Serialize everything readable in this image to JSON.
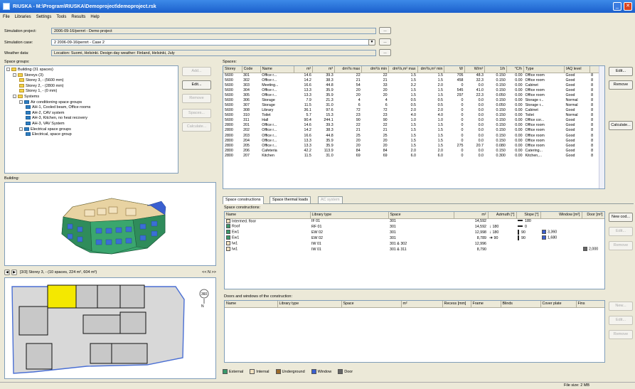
{
  "window": {
    "title": "RIUSKA - M:\\Program\\RIUSKA\\Demoproject\\demoproject.rsk"
  },
  "menu": [
    "File",
    "Libraries",
    "Settings",
    "Tools",
    "Results",
    "Help"
  ],
  "form": {
    "project_label": "Simulation project:",
    "project_value": "2006-09-16/pernrt - Demo project",
    "case_label": "Simulation case:",
    "case_value": "2  2006-09-16/pernrt - Case 2",
    "weather_label": "Weather data:",
    "weather_value": "Location: Suomi, Helsinki. Design day weather: Finland, Helsinki, July"
  },
  "space_groups": {
    "label": "Space groups:",
    "tree": [
      {
        "text": "Building (31 spaces)",
        "indent": 0,
        "icon": "folder",
        "pm": "-"
      },
      {
        "text": "Storeys (3)",
        "indent": 1,
        "icon": "folder",
        "pm": "-"
      },
      {
        "text": "Storey 3, - (5600 mm)",
        "indent": 2,
        "icon": "folder",
        "pm": ""
      },
      {
        "text": "Storey 2, - (2800 mm)",
        "indent": 2,
        "icon": "folder",
        "pm": ""
      },
      {
        "text": "Storey 1, - (0 mm)",
        "indent": 2,
        "icon": "folder",
        "pm": ""
      },
      {
        "text": "Systems",
        "indent": 1,
        "icon": "folder",
        "pm": "-"
      },
      {
        "text": "Air conditioning space groups",
        "indent": 2,
        "icon": "system",
        "pm": "-"
      },
      {
        "text": "AH-1, Cooled beam, Office rooms",
        "indent": 3,
        "icon": "system",
        "pm": ""
      },
      {
        "text": "AH-2, CAV system",
        "indent": 3,
        "icon": "system",
        "pm": ""
      },
      {
        "text": "AH-3, Kitchen, no heat recovery",
        "indent": 3,
        "icon": "system",
        "pm": ""
      },
      {
        "text": "AH-3, VAV System",
        "indent": 3,
        "icon": "system",
        "pm": ""
      },
      {
        "text": "Electrical space groups",
        "indent": 2,
        "icon": "system",
        "pm": "-"
      },
      {
        "text": "Electrical, space group",
        "indent": 3,
        "icon": "system",
        "pm": ""
      }
    ],
    "buttons": {
      "add": "Add...",
      "edit": "Edit...",
      "remove": "Remove",
      "spaces": "Spaces...",
      "calculate": "Calculate..."
    }
  },
  "building_label": "Building:",
  "floor_nav": {
    "text": "[3/3] Storey 3, - (10 spaces, 224 m², 604 m³)",
    "zoom": "<< N >>",
    "compass": "N"
  },
  "spaces": {
    "label": "Spaces:",
    "columns": [
      "Storey",
      "Code",
      "Name",
      "m²",
      "m³",
      "dm³/s max",
      "dm³/s min",
      "dm³/s,m² max",
      "dm³/s,m² min",
      "W",
      "W/m²",
      "1/h",
      "°C/h",
      "Type",
      "IAQ level"
    ],
    "rows": [
      [
        "5600",
        "301",
        "Office r...",
        "14.6",
        "39.3",
        "22",
        "22",
        "1.5",
        "1.5",
        "705",
        "48.3",
        "0.150",
        "0.00",
        "Office room",
        "Good",
        "8"
      ],
      [
        "5600",
        "302",
        "Office r...",
        "14.2",
        "38.3",
        "21",
        "21",
        "1.5",
        "1.5",
        "458",
        "32.3",
        "0.150",
        "0.00",
        "Office room",
        "Good",
        "8"
      ],
      [
        "5600",
        "303",
        "Meeting...",
        "16.6",
        "44.8",
        "54",
        "33",
        "3.2",
        "2.0",
        "0",
        "0.0",
        "0.150",
        "0.00",
        "Cabinet",
        "Good",
        "8"
      ],
      [
        "5600",
        "304",
        "Office r...",
        "13.3",
        "35.9",
        "20",
        "20",
        "1.5",
        "1.5",
        "545",
        "41.0",
        "0.150",
        "0.00",
        "Office room",
        "Good",
        "8"
      ],
      [
        "5600",
        "305",
        "Office r...",
        "13.3",
        "35.9",
        "20",
        "20",
        "1.5",
        "1.5",
        "297",
        "22.3",
        "0.050",
        "0.00",
        "Office room",
        "Good",
        "8"
      ],
      [
        "5600",
        "306",
        "Storage",
        "7.9",
        "21.3",
        "4",
        "4",
        "0.5",
        "0.5",
        "0",
        "0.0",
        "0.150",
        "0.00",
        "Storage r...",
        "Normal",
        "8"
      ],
      [
        "5600",
        "307",
        "Storage",
        "11.5",
        "31.0",
        "6",
        "6",
        "0.5",
        "0.5",
        "0",
        "0.0",
        "0.050",
        "0.00",
        "Storage r...",
        "Normal",
        "8"
      ],
      [
        "5600",
        "308",
        "Library",
        "36.1",
        "97.6",
        "72",
        "72",
        "2.0",
        "2.0",
        "0",
        "0.0",
        "0.150",
        "0.00",
        "Cabinet",
        "Good",
        "8"
      ],
      [
        "5600",
        "310",
        "Toilet",
        "5.7",
        "15.3",
        "23",
        "23",
        "4.0",
        "4.0",
        "0",
        "0.0",
        "0.150",
        "0.00",
        "Toilet",
        "Normal",
        "8"
      ],
      [
        "5600",
        "311",
        "Hall",
        "90.4",
        "244.1",
        "90",
        "90",
        "1.0",
        "1.0",
        "0",
        "0.0",
        "0.150",
        "0.00",
        "Office cor...",
        "Good",
        "8"
      ],
      [
        "2800",
        "201",
        "Office r...",
        "14.6",
        "39.3",
        "22",
        "22",
        "1.5",
        "1.5",
        "0",
        "0.0",
        "0.150",
        "0.00",
        "Office room",
        "Good",
        "8"
      ],
      [
        "2800",
        "202",
        "Office r...",
        "14.2",
        "38.3",
        "21",
        "21",
        "1.5",
        "1.5",
        "0",
        "0.0",
        "0.150",
        "0.00",
        "Office room",
        "Good",
        "8"
      ],
      [
        "2800",
        "203",
        "Office r...",
        "16.6",
        "44.8",
        "25",
        "25",
        "1.5",
        "1.5",
        "0",
        "0.0",
        "0.150",
        "0.00",
        "Office room",
        "Good",
        "8"
      ],
      [
        "2800",
        "204",
        "Office r...",
        "13.3",
        "35.9",
        "20",
        "20",
        "1.5",
        "1.5",
        "0",
        "0.0",
        "0.150",
        "0.00",
        "Office room",
        "Good",
        "8"
      ],
      [
        "2800",
        "205",
        "Office r...",
        "13.3",
        "35.9",
        "20",
        "20",
        "1.5",
        "1.5",
        "275",
        "20.7",
        "0.080",
        "0.00",
        "Office room",
        "Good",
        "8"
      ],
      [
        "2800",
        "206",
        "Cafeteria",
        "42.2",
        "113.9",
        "84",
        "84",
        "2.0",
        "2.0",
        "0",
        "0.0",
        "0.150",
        "0.00",
        "Catering...",
        "Good",
        "8"
      ],
      [
        "2800",
        "207",
        "Kitchen",
        "11.5",
        "31.0",
        "69",
        "69",
        "6.0",
        "6.0",
        "0",
        "0.0",
        "0.300",
        "0.00",
        "Kitchen,...",
        "Good",
        "8"
      ]
    ],
    "buttons": {
      "edit": "Edit...",
      "remove": "Remove",
      "calculate": "Calculate..."
    }
  },
  "tabs": [
    "Space constructions",
    "Space thermal loads",
    "AC system"
  ],
  "constructions": {
    "label": "Space constructions:",
    "columns": [
      "Name",
      "Library type",
      "Space",
      "m²",
      "Azimuth [°]",
      "Slope [°]",
      "Window [m²]",
      "Door [m²]"
    ],
    "rows": [
      {
        "name": "Intermed. floor",
        "type": "IF 01",
        "space": "301",
        "area": "14,592",
        "az": "",
        "slope": "180",
        "win": "",
        "door": "",
        "color": "#f2e2bf"
      },
      {
        "name": "Roof",
        "type": "RF 01",
        "space": "301",
        "area": "14,592",
        "az": "180",
        "slope": "0",
        "win": "",
        "door": "",
        "color": "#3a9a6a"
      },
      {
        "name": "Ew1",
        "type": "EW 02",
        "space": "301",
        "area": "12,998",
        "az": "180",
        "slope": "90",
        "win": "3,360",
        "door": "",
        "color": "#3a9a6a"
      },
      {
        "name": "Ew1",
        "type": "EW 02",
        "space": "301",
        "area": "8,789",
        "az": "90",
        "slope": "90",
        "win": "1,680",
        "door": "",
        "color": "#3a9a6a"
      },
      {
        "name": "Iw1",
        "type": "IW 01",
        "space": "301 & 302",
        "area": "12,996",
        "az": "",
        "slope": "",
        "win": "",
        "door": "",
        "color": "#f2e2bf"
      },
      {
        "name": "Iw1",
        "type": "IW 01",
        "space": "301 & 311",
        "area": "8,790",
        "az": "",
        "slope": "",
        "win": "",
        "door": "2,000",
        "color": "#f2e2bf"
      }
    ],
    "buttons": {
      "new": "New cod...",
      "edit": "Edit...",
      "remove": "Remove"
    }
  },
  "doors_windows": {
    "label": "Doors and windows of the construction:",
    "columns": [
      "Name",
      "Library type",
      "Space",
      "m²",
      "Recess [mm]",
      "Frame",
      "Blinds",
      "Cover plate",
      "Fins"
    ],
    "buttons": {
      "new": "New...",
      "edit": "Edit...",
      "remove": "Remove"
    }
  },
  "legend": [
    {
      "label": "External",
      "color": "#3a9a6a"
    },
    {
      "label": "Internal",
      "color": "#f2e2bf"
    },
    {
      "label": "Underground",
      "color": "#9a6a2a"
    },
    {
      "label": "Window",
      "color": "#3a5fd0"
    },
    {
      "label": "Door",
      "color": "#666666"
    }
  ],
  "status": {
    "filesize": "File size: 2 MB"
  }
}
